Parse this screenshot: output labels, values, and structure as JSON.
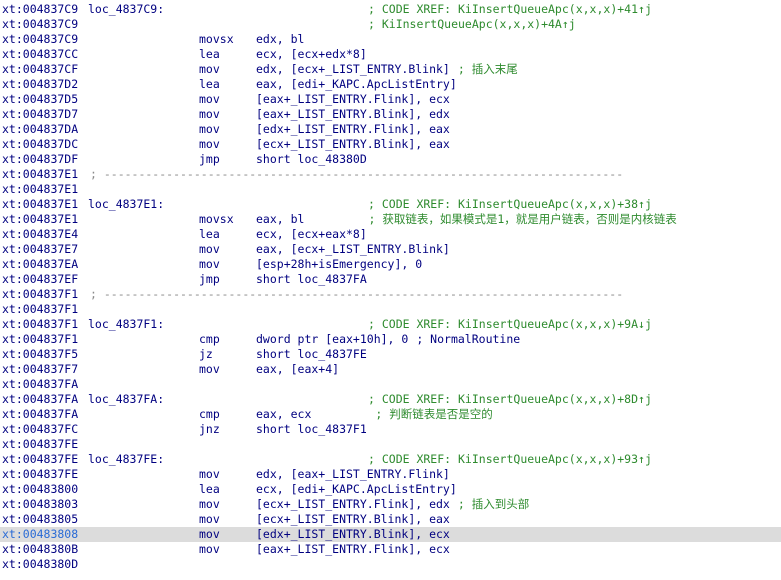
{
  "listing": [
    {
      "addr": "xt:004837C9",
      "label": "loc_4837C9:",
      "xref": "; CODE XREF: KiInsertQueueApc(x,x,x)+41↑j"
    },
    {
      "addr": "xt:004837C9",
      "xref": "; KiInsertQueueApc(x,x,x)+4A↑j"
    },
    {
      "addr": "xt:004837C9",
      "mnem": "movsx",
      "ops": "edx, bl"
    },
    {
      "addr": "xt:004837CC",
      "mnem": "lea",
      "ops": "ecx, [ecx+edx*8]"
    },
    {
      "addr": "xt:004837CF",
      "mnem": "mov",
      "ops": "edx, [ecx+_LIST_ENTRY.Blink]",
      "comment": "; 插入末尾"
    },
    {
      "addr": "xt:004837D2",
      "mnem": "lea",
      "ops": "eax, [edi+_KAPC.ApcListEntry]"
    },
    {
      "addr": "xt:004837D5",
      "mnem": "mov",
      "ops": "[eax+_LIST_ENTRY.Flink], ecx"
    },
    {
      "addr": "xt:004837D7",
      "mnem": "mov",
      "ops": "[eax+_LIST_ENTRY.Blink], edx"
    },
    {
      "addr": "xt:004837DA",
      "mnem": "mov",
      "ops": "[edx+_LIST_ENTRY.Flink], eax"
    },
    {
      "addr": "xt:004837DC",
      "mnem": "mov",
      "ops": "[ecx+_LIST_ENTRY.Blink], eax"
    },
    {
      "addr": "xt:004837DF",
      "mnem": "jmp",
      "ops": "short loc_48380D"
    },
    {
      "addr": "xt:004837E1",
      "separator": "; ---------------------------------------------------------------------------"
    },
    {
      "addr": "xt:004837E1"
    },
    {
      "addr": "xt:004837E1",
      "label": "loc_4837E1:",
      "xref": "; CODE XREF: KiInsertQueueApc(x,x,x)+38↑j"
    },
    {
      "addr": "xt:004837E1",
      "mnem": "movsx",
      "ops": "eax, bl",
      "comment": "; 获取链表，如果模式是1，就是用户链表，否则是内核链表",
      "comment_pad": "        "
    },
    {
      "addr": "xt:004837E4",
      "mnem": "lea",
      "ops": "ecx, [ecx+eax*8]"
    },
    {
      "addr": "xt:004837E7",
      "mnem": "mov",
      "ops": "eax, [ecx+_LIST_ENTRY.Blink]"
    },
    {
      "addr": "xt:004837EA",
      "mnem": "mov",
      "ops": "[esp+28h+isEmergency], 0"
    },
    {
      "addr": "xt:004837EF",
      "mnem": "jmp",
      "ops": "short loc_4837FA"
    },
    {
      "addr": "xt:004837F1",
      "separator": "; ---------------------------------------------------------------------------"
    },
    {
      "addr": "xt:004837F1"
    },
    {
      "addr": "xt:004837F1",
      "label": "loc_4837F1:",
      "xref": "; CODE XREF: KiInsertQueueApc(x,x,x)+9A↓j"
    },
    {
      "addr": "xt:004837F1",
      "mnem": "cmp",
      "ops": "dword ptr [eax+10h], 0",
      "comment": "; NormalRoutine",
      "comment_style": "blue"
    },
    {
      "addr": "xt:004837F5",
      "mnem": "jz",
      "ops": "short loc_4837FE"
    },
    {
      "addr": "xt:004837F7",
      "mnem": "mov",
      "ops": "eax, [eax+4]"
    },
    {
      "addr": "xt:004837FA"
    },
    {
      "addr": "xt:004837FA",
      "label": "loc_4837FA:",
      "xref": "; CODE XREF: KiInsertQueueApc(x,x,x)+8D↑j"
    },
    {
      "addr": "xt:004837FA",
      "mnem": "cmp",
      "ops": "eax, ecx",
      "comment": "; 判断链表是否是空的",
      "comment_pad": "        "
    },
    {
      "addr": "xt:004837FC",
      "mnem": "jnz",
      "ops": "short loc_4837F1"
    },
    {
      "addr": "xt:004837FE"
    },
    {
      "addr": "xt:004837FE",
      "label": "loc_4837FE:",
      "xref": "; CODE XREF: KiInsertQueueApc(x,x,x)+93↑j"
    },
    {
      "addr": "xt:004837FE",
      "mnem": "mov",
      "ops": "edx, [eax+_LIST_ENTRY.Flink]"
    },
    {
      "addr": "xt:00483800",
      "mnem": "lea",
      "ops": "ecx, [edi+_KAPC.ApcListEntry]"
    },
    {
      "addr": "xt:00483803",
      "mnem": "mov",
      "ops": "[ecx+_LIST_ENTRY.Flink], edx",
      "comment": "; 插入到头部"
    },
    {
      "addr": "xt:00483805",
      "mnem": "mov",
      "ops": "[ecx+_LIST_ENTRY.Blink], eax"
    },
    {
      "addr": "xt:00483808",
      "mnem": "mov",
      "ops": "[edx+_LIST_ENTRY.Blink], ecx",
      "highlighted": true
    },
    {
      "addr": "xt:0048380B",
      "mnem": "mov",
      "ops": "[eax+_LIST_ENTRY.Flink], ecx"
    },
    {
      "addr": "xt:0048380D"
    }
  ]
}
